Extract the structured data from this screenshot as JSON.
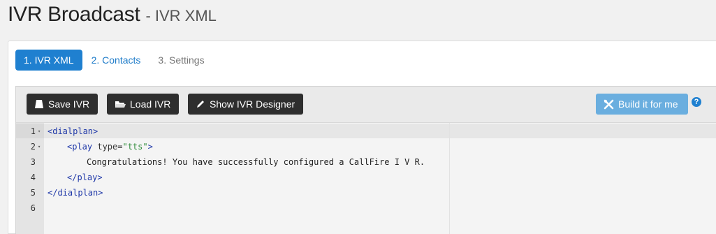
{
  "header": {
    "title": "IVR Broadcast",
    "separator": "-",
    "subtitle": "IVR XML"
  },
  "tabs": [
    {
      "label": "1. IVR XML",
      "state": "active"
    },
    {
      "label": "2. Contacts",
      "state": "link"
    },
    {
      "label": "3. Settings",
      "state": "muted"
    }
  ],
  "toolbar": {
    "save_label": "Save IVR",
    "load_label": "Load IVR",
    "designer_label": "Show IVR Designer",
    "build_label": "Build it for me",
    "help_glyph": "?"
  },
  "editor": {
    "lines": [
      {
        "number": "1",
        "fold": "▾"
      },
      {
        "number": "2",
        "fold": "▾"
      },
      {
        "number": "3",
        "fold": ""
      },
      {
        "number": "4",
        "fold": ""
      },
      {
        "number": "5",
        "fold": ""
      },
      {
        "number": "6",
        "fold": ""
      }
    ],
    "code": {
      "l1_open": "<dialplan>",
      "l2_tag_open": "<play",
      "l2_attr": " type=",
      "l2_value": "\"tts\"",
      "l2_close": ">",
      "l3_text": "Congratulations! You have successfully configured a CallFire I V R.",
      "l4_close": "</play>",
      "l5_close": "</dialplan>"
    }
  },
  "colors": {
    "primary": "#1f80d0",
    "dark_button": "#2e2e2e",
    "build_button": "#6aaedf",
    "xml_tag": "#1f38a8",
    "xml_string": "#2e8b3a"
  }
}
